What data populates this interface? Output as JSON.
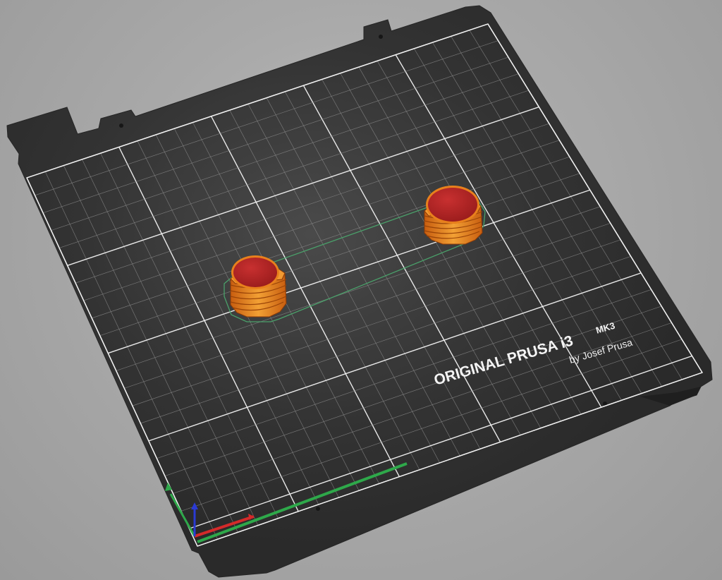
{
  "scene": {
    "background_color": "#a8a8a8",
    "bed_color": "#2e2e2e",
    "grid_minor_color": "#8a8a8a",
    "grid_major_color": "#f2f2f2",
    "part_top_color": "#b82424",
    "part_side_color": "#e07818",
    "outline_color": "#4aa06a"
  },
  "bed": {
    "brand_title": "ORIGINAL PRUSA i3",
    "brand_model": "MK3",
    "brand_by": "by Josef Prusa"
  },
  "objects": [
    {
      "name": "left-cylinder"
    },
    {
      "name": "right-cylinder"
    }
  ],
  "axes": {
    "x_color": "#d42a2a",
    "y_color": "#2ea84a",
    "z_color": "#2a3ad4"
  }
}
